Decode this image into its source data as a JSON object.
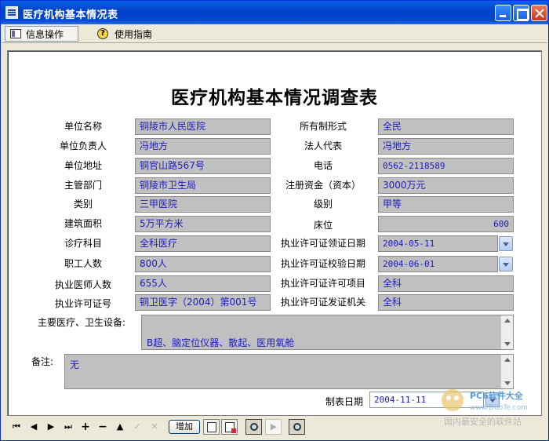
{
  "window": {
    "title": "医疗机构基本情况表"
  },
  "toolbar": {
    "tab_info": "信息操作",
    "tab_guide": "使用指南"
  },
  "form": {
    "title": "医疗机构基本情况调查表",
    "left_labels": [
      "单位名称",
      "单位负责人",
      "单位地址",
      "主管部门",
      "类别",
      "建筑面积",
      "诊疗科目",
      "职工人数",
      "执业医师人数",
      "执业许可证号"
    ],
    "left_values": [
      "铜陵市人民医院",
      "冯地方",
      "铜官山路567号",
      "铜陵市卫生局",
      "三甲医院",
      "5万平方米",
      "全科医疗",
      "800人",
      "655人",
      "铜卫医字（2004）第001号"
    ],
    "right_labels": [
      "所有制形式",
      "法人代表",
      "电话",
      "注册资金（资本）",
      "级别",
      "床位",
      "执业许可证领证日期",
      "执业许可证校验日期",
      "执业许可证许可项目",
      "执业许可证发证机关"
    ],
    "right_values": [
      "全民",
      "冯地方",
      "0562-2118589",
      "3000万元",
      "甲等",
      "600",
      "2004-05-11",
      "2004-06-01",
      "全科",
      "全科"
    ],
    "equipment_label": "主要医疗、卫生设备:",
    "equipment_value": "B超、脑定位仪器、散起、医用氧舱",
    "remarks_label": "备注:",
    "remarks_value": "无",
    "date_label": "制表日期",
    "date_value": "2004-11-11"
  },
  "navbar": {
    "first": "⏮",
    "prev": "◀",
    "next": "▶",
    "last": "⏭",
    "plus": "+",
    "minus": "−",
    "up": "▲",
    "check": "✓",
    "cancel": "✕",
    "add_label": "增加"
  },
  "watermark": {
    "logo": "www.DuoTe.com",
    "brand": "PC6软件大全",
    "url": "www.DuoTe.com",
    "sub": "国内最安全的软件站"
  }
}
